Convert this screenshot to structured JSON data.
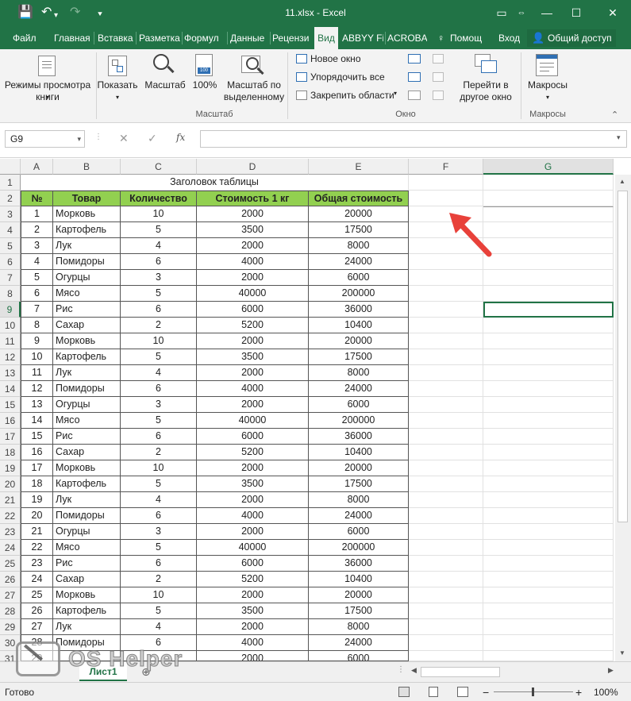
{
  "window": {
    "title": "11.xlsx - Excel",
    "qa_save": "💾",
    "qa_undo": "↶",
    "qa_redo": "↷",
    "qa_customize": "⯆",
    "restore_icon": "▭",
    "minimize": "—",
    "maximize": "☐",
    "close": "✕"
  },
  "tabs": [
    "Файл",
    "Главная",
    "Вставка",
    "Разметка",
    "Формул",
    "Данные",
    "Рецензи",
    "Вид",
    "ABBYY Fi",
    "ACROBA"
  ],
  "tell_me": "Помощ",
  "signin": "Вход",
  "share": "Общий доступ",
  "ribbon": {
    "view_modes": "Режимы просмотра книги",
    "show": "Показать",
    "zoom": "Масштаб",
    "zoom100": "100%",
    "zoom_selection": "Масштаб по выделенному",
    "group_zoom": "Масштаб",
    "new_window": "Новое окно",
    "arrange_all": "Упорядочить все",
    "freeze_panes": "Закрепить области",
    "switch_windows": "Перейти в другое окно",
    "group_window": "Окно",
    "macros": "Макросы",
    "group_macros": "Макросы"
  },
  "formula": {
    "namebox": "G9",
    "fx": "fx",
    "value": ""
  },
  "columns": [
    "A",
    "B",
    "C",
    "D",
    "E",
    "F",
    "G"
  ],
  "sheet": {
    "title_cell": "Заголовок таблицы",
    "headers": [
      "№",
      "Товар",
      "Количество",
      "Стоимость 1 кг",
      "Общая стоимость"
    ],
    "rows": [
      [
        "1",
        "Морковь",
        "10",
        "2000",
        "20000"
      ],
      [
        "2",
        "Картофель",
        "5",
        "3500",
        "17500"
      ],
      [
        "3",
        "Лук",
        "4",
        "2000",
        "8000"
      ],
      [
        "4",
        "Помидоры",
        "6",
        "4000",
        "24000"
      ],
      [
        "5",
        "Огурцы",
        "3",
        "2000",
        "6000"
      ],
      [
        "6",
        "Мясо",
        "5",
        "40000",
        "200000"
      ],
      [
        "7",
        "Рис",
        "6",
        "6000",
        "36000"
      ],
      [
        "8",
        "Сахар",
        "2",
        "5200",
        "10400"
      ],
      [
        "9",
        "Морковь",
        "10",
        "2000",
        "20000"
      ],
      [
        "10",
        "Картофель",
        "5",
        "3500",
        "17500"
      ],
      [
        "11",
        "Лук",
        "4",
        "2000",
        "8000"
      ],
      [
        "12",
        "Помидоры",
        "6",
        "4000",
        "24000"
      ],
      [
        "13",
        "Огурцы",
        "3",
        "2000",
        "6000"
      ],
      [
        "14",
        "Мясо",
        "5",
        "40000",
        "200000"
      ],
      [
        "15",
        "Рис",
        "6",
        "6000",
        "36000"
      ],
      [
        "16",
        "Сахар",
        "2",
        "5200",
        "10400"
      ],
      [
        "17",
        "Морковь",
        "10",
        "2000",
        "20000"
      ],
      [
        "18",
        "Картофель",
        "5",
        "3500",
        "17500"
      ],
      [
        "19",
        "Лук",
        "4",
        "2000",
        "8000"
      ],
      [
        "20",
        "Помидоры",
        "6",
        "4000",
        "24000"
      ],
      [
        "21",
        "Огурцы",
        "3",
        "2000",
        "6000"
      ],
      [
        "22",
        "Мясо",
        "5",
        "40000",
        "200000"
      ],
      [
        "23",
        "Рис",
        "6",
        "6000",
        "36000"
      ],
      [
        "24",
        "Сахар",
        "2",
        "5200",
        "10400"
      ],
      [
        "25",
        "Морковь",
        "10",
        "2000",
        "20000"
      ],
      [
        "26",
        "Картофель",
        "5",
        "3500",
        "17500"
      ],
      [
        "27",
        "Лук",
        "4",
        "2000",
        "8000"
      ],
      [
        "28",
        "Помидоры",
        "6",
        "4000",
        "24000"
      ],
      [
        "29",
        "",
        "",
        "2000",
        "6000"
      ]
    ],
    "row_numbers": [
      "1",
      "2",
      "3",
      "4",
      "5",
      "6",
      "7",
      "8",
      "9",
      "10",
      "11",
      "12",
      "13",
      "14",
      "15",
      "16",
      "17",
      "18",
      "19",
      "20",
      "21",
      "22",
      "23",
      "24",
      "25",
      "26",
      "27",
      "28",
      "29",
      "30",
      "31"
    ]
  },
  "sheet_tab": "Лист1",
  "status": {
    "ready": "Готово",
    "zoom": "100%",
    "minus": "−",
    "plus": "+"
  },
  "watermark": "OS Helper",
  "colors": {
    "excel_green": "#217346",
    "header_fill": "#92d050",
    "arrow": "#e8413a"
  }
}
